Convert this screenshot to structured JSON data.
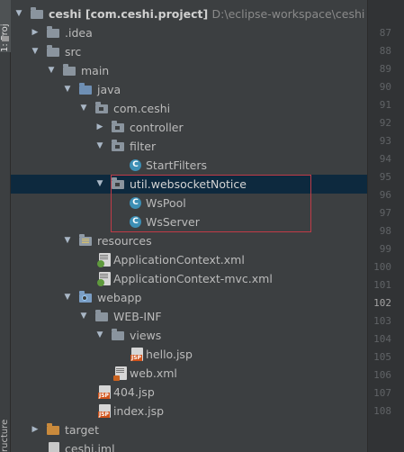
{
  "side_tabs": {
    "project": "1: Proj",
    "structure": "ructure"
  },
  "tree": {
    "project": {
      "name": "ceshi",
      "module": "[com.ceshi.project]",
      "path": "D:\\eclipse-workspace\\ceshi"
    },
    "idea": ".idea",
    "src": "src",
    "main": "main",
    "java": "java",
    "com_ceshi": "com.ceshi",
    "controller": "controller",
    "filter": "filter",
    "start_filters": "StartFilters",
    "util_ws": "util.websocketNotice",
    "ws_pool": "WsPool",
    "ws_server": "WsServer",
    "resources": "resources",
    "app_context": "ApplicationContext.xml",
    "app_context_mvc": "ApplicationContext-mvc.xml",
    "webapp": "webapp",
    "web_inf": "WEB-INF",
    "views": "views",
    "hello_jsp": "hello.jsp",
    "web_xml": "web.xml",
    "jsp_404": "404.jsp",
    "index_jsp": "index.jsp",
    "target": "target",
    "ceshi_iml": "ceshi.iml"
  },
  "class_icon_letter": "C",
  "gutter": {
    "lines": [
      "87",
      "88",
      "89",
      "90",
      "91",
      "92",
      "93",
      "94",
      "95",
      "96",
      "97",
      "98",
      "99",
      "100",
      "101",
      "102",
      "103",
      "104",
      "105",
      "106",
      "107",
      "108"
    ],
    "current_line": "102"
  },
  "colors": {
    "background": "#3c3f41",
    "selection": "#0d293e",
    "highlight_box": "#c03b47",
    "class_icon": "#3d8fb5"
  }
}
